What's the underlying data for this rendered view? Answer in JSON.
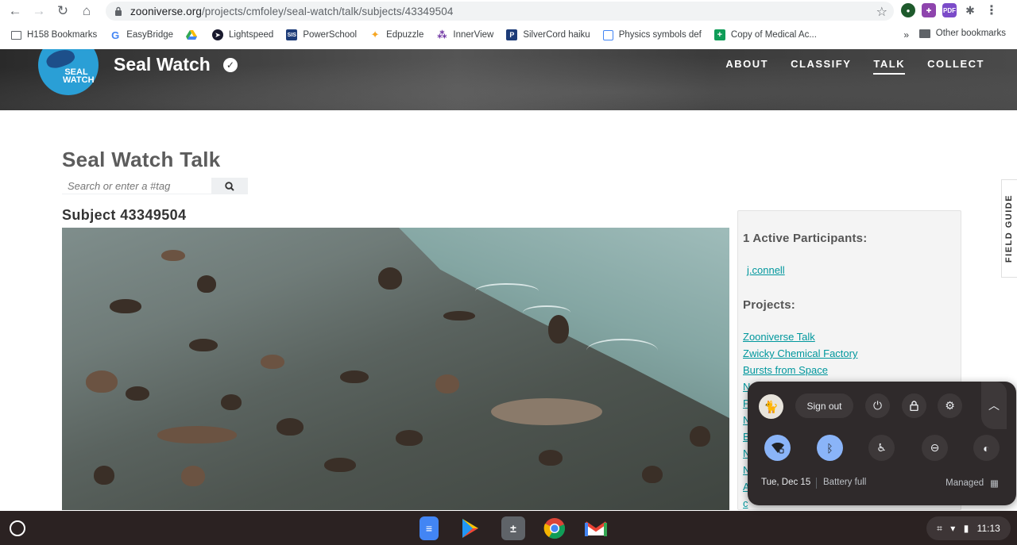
{
  "browser": {
    "url_host": "zooniverse.org",
    "url_path": "/projects/cmfoley/seal-watch/talk/subjects/43349504",
    "bookmarks": [
      {
        "label": "H158 Bookmarks",
        "icon": "folder-icon"
      },
      {
        "label": "EasyBridge",
        "icon": "google-g-icon"
      },
      {
        "label": "",
        "icon": "google-drive-icon"
      },
      {
        "label": "Lightspeed",
        "icon": "lightspeed-icon"
      },
      {
        "label": "PowerSchool",
        "icon": "powerschool-icon"
      },
      {
        "label": "Edpuzzle",
        "icon": "edpuzzle-icon"
      },
      {
        "label": "InnerView",
        "icon": "innerview-icon"
      },
      {
        "label": "SilverCord haiku",
        "icon": "silvercord-icon"
      },
      {
        "label": "Physics symbols def",
        "icon": "docs-icon"
      },
      {
        "label": "Copy of Medical Ac...",
        "icon": "sheets-icon"
      }
    ],
    "more_bookmarks": "»",
    "other_bookmarks": "Other bookmarks"
  },
  "site": {
    "logo_text": "SEAL WATCH",
    "title": "Seal Watch",
    "nav": [
      "ABOUT",
      "CLASSIFY",
      "TALK",
      "COLLECT"
    ],
    "active_nav": "TALK"
  },
  "main": {
    "talk_title": "Seal Watch Talk",
    "search_placeholder": "Search or enter a #tag",
    "subject_title": "Subject 43349504"
  },
  "sidebar": {
    "participants_heading": "1 Active Participants:",
    "participant": "j.connell",
    "projects_heading": "Projects:",
    "projects": [
      "Zooniverse Talk",
      "Zwicky Chemical Factory",
      "Bursts from Space",
      "N",
      "P",
      "N",
      "B",
      "N",
      "N",
      "A",
      "c"
    ]
  },
  "field_guide": "FIELD GUIDE",
  "tray": {
    "sign_out": "Sign out",
    "date": "Tue, Dec 15",
    "battery": "Battery full",
    "managed": "Managed"
  },
  "shelf": {
    "time": "11:13"
  }
}
